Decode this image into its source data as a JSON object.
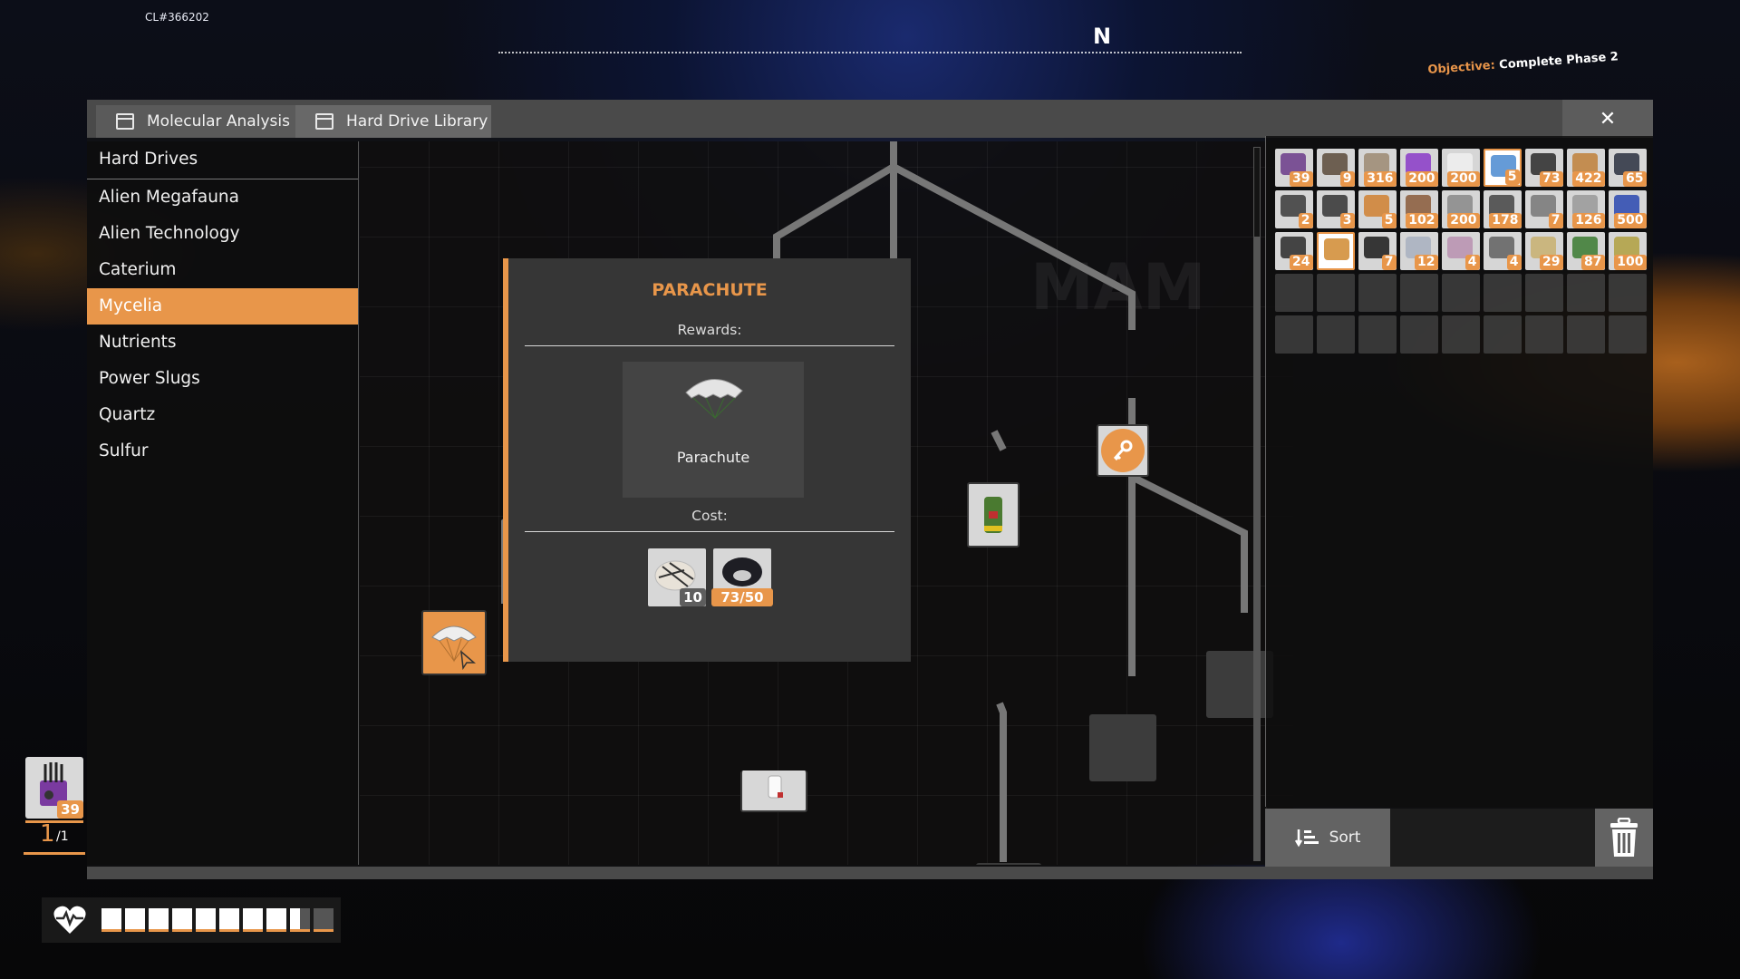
{
  "hud": {
    "build_id": "CL#366202",
    "compass_heading": "N",
    "objective_label": "Objective:",
    "objective_value": "Complete Phase 2"
  },
  "window": {
    "tabs": [
      {
        "label": "Molecular Analysis Machine",
        "display": "Molecular Analysis Mа",
        "icon": "window-icon",
        "active": false
      },
      {
        "label": "Hard Drive Library",
        "icon": "window-icon",
        "active": true
      }
    ],
    "close_glyph": "✕"
  },
  "sidebar": {
    "items": [
      {
        "label": "Hard Drives",
        "header": true
      },
      {
        "label": "Alien Megafauna"
      },
      {
        "label": "Alien Technology"
      },
      {
        "label": "Caterium"
      },
      {
        "label": "Mycelia",
        "selected": true
      },
      {
        "label": "Nutrients"
      },
      {
        "label": "Power Slugs"
      },
      {
        "label": "Quartz"
      },
      {
        "label": "Sulfur"
      }
    ]
  },
  "tree": {
    "background_text": "MAM",
    "nodes": [
      {
        "id": "parachute",
        "icon": "parachute-icon",
        "state": "selected"
      },
      {
        "id": "green-canister",
        "icon": "canister-icon",
        "state": "available"
      },
      {
        "id": "key",
        "icon": "key-icon",
        "state": "available"
      },
      {
        "id": "medkit-person",
        "icon": "medkit-icon",
        "state": "available"
      },
      {
        "id": "gas-mask",
        "icon": "gas-mask-icon",
        "state": "available"
      },
      {
        "id": "locked-1",
        "icon": "",
        "state": "locked"
      },
      {
        "id": "locked-2",
        "icon": "",
        "state": "locked"
      }
    ]
  },
  "tooltip": {
    "title": "PARACHUTE",
    "rewards_label": "Rewards:",
    "reward": {
      "name": "Parachute",
      "icon": "parachute-icon"
    },
    "cost_label": "Cost:",
    "costs": [
      {
        "item": "Fabric",
        "icon": "fabric-icon",
        "amount": "10"
      },
      {
        "item": "Cable",
        "icon": "cable-icon",
        "amount": "73/50"
      }
    ]
  },
  "inventory": {
    "slots": [
      {
        "icon": "hard-drive-icon",
        "count": "39",
        "color": "#6b3b8a"
      },
      {
        "icon": "logs-icon",
        "count": "9",
        "color": "#5a4a3a"
      },
      {
        "icon": "sand-bag-icon",
        "count": "316",
        "color": "#9c8a72"
      },
      {
        "icon": "crystal-icon",
        "count": "200",
        "color": "#8a3ac8"
      },
      {
        "icon": "block-icon",
        "count": "200",
        "color": "#f0f0f0"
      },
      {
        "icon": "canister-icon",
        "count": "5",
        "color": "#4a8ad0",
        "highlight": true
      },
      {
        "icon": "cable-icon",
        "count": "73",
        "color": "#2a2a2a"
      },
      {
        "icon": "wire-spool-icon",
        "count": "422",
        "color": "#c0803a"
      },
      {
        "icon": "motor-icon",
        "count": "65",
        "color": "#2a3040"
      },
      {
        "icon": "pipes-icon",
        "count": "2",
        "color": "#3a3a3a"
      },
      {
        "icon": "frame-icon",
        "count": "3",
        "color": "#333"
      },
      {
        "icon": "battery-icon",
        "count": "5",
        "color": "#d08030"
      },
      {
        "icon": "copper-rod-icon",
        "count": "102",
        "color": "#8a5a3a"
      },
      {
        "icon": "plate-icon",
        "count": "200",
        "color": "#888"
      },
      {
        "icon": "rod-icon",
        "count": "178",
        "color": "#444"
      },
      {
        "icon": "frame-cube-icon",
        "count": "7",
        "color": "#777"
      },
      {
        "icon": "sheet-icon",
        "count": "126",
        "color": "#999"
      },
      {
        "icon": "ore-bin-icon",
        "count": "500",
        "color": "#2a48b0"
      },
      {
        "icon": "beam-icon",
        "count": "24",
        "color": "#2a2a2a"
      },
      {
        "icon": "beacon-icon",
        "count": "",
        "color": "#d08a30",
        "highlight": true
      },
      {
        "icon": "coal-icon",
        "count": "7",
        "color": "#1a1a1a"
      },
      {
        "icon": "glass-sheet-icon",
        "count": "12",
        "color": "#a8b0c0"
      },
      {
        "icon": "pink-ore-icon",
        "count": "4",
        "color": "#b890b0"
      },
      {
        "icon": "stone-icon",
        "count": "4",
        "color": "#606060"
      },
      {
        "icon": "gold-ingot-icon",
        "count": "29",
        "color": "#c8b070"
      },
      {
        "icon": "leaves-icon",
        "count": "87",
        "color": "#3a7a30"
      },
      {
        "icon": "wood-chips-icon",
        "count": "100",
        "color": "#b0a040"
      }
    ],
    "empty_slots": 18,
    "sort_label": "Sort"
  },
  "player_hud": {
    "equipped_count": "39",
    "slot_current": "1",
    "slot_total": "/1",
    "health_fraction": 0.85,
    "health_segments": 10
  }
}
